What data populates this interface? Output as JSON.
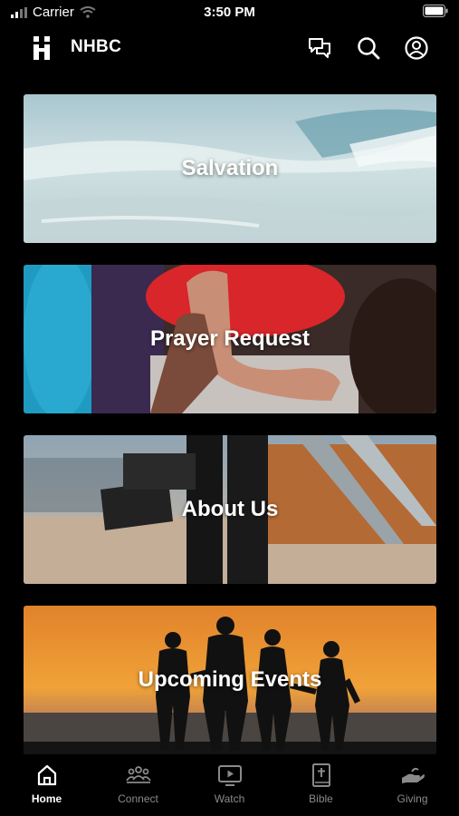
{
  "status_bar": {
    "carrier": "Carrier",
    "time": "3:50 PM",
    "icons": [
      "signal-bars-icon",
      "wifi-icon",
      "battery-icon"
    ]
  },
  "header": {
    "brand": "NHBC",
    "icons": [
      "logo-icon",
      "chat-bubbles-icon",
      "search-icon",
      "account-icon"
    ]
  },
  "cards": [
    {
      "title": "Salvation",
      "image": "ocean-waves-photo"
    },
    {
      "title": "Prayer Request",
      "image": "high-five-hands-photo"
    },
    {
      "title": "About Us",
      "image": "camera-operator-beach-photo"
    },
    {
      "title": "Upcoming Events",
      "image": "sunset-silhouettes-photo"
    }
  ],
  "tabbar": {
    "tabs": [
      {
        "label": "Home",
        "icon": "home-icon",
        "active": true
      },
      {
        "label": "Connect",
        "icon": "people-group-icon",
        "active": false
      },
      {
        "label": "Watch",
        "icon": "video-play-icon",
        "active": false
      },
      {
        "label": "Bible",
        "icon": "bible-icon",
        "active": false
      },
      {
        "label": "Giving",
        "icon": "giving-hand-icon",
        "active": false
      }
    ]
  },
  "colors": {
    "background": "#000000",
    "text": "#ffffff",
    "tab_inactive": "#8a8a8a"
  }
}
